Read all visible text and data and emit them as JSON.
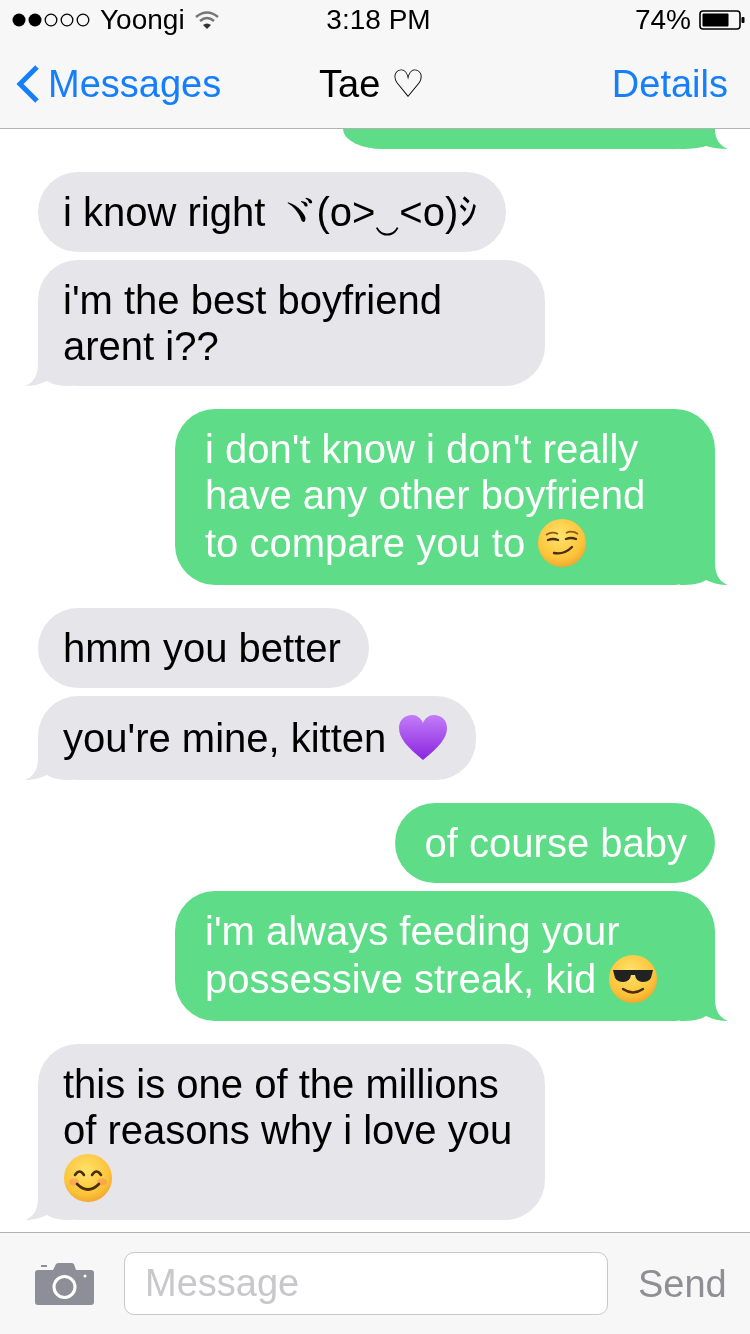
{
  "status_bar": {
    "carrier": "Yoongi",
    "time": "3:18 PM",
    "battery": "74%"
  },
  "nav_bar": {
    "back_label": "Messages",
    "title": "Tae ♡",
    "action": "Details"
  },
  "messages": [
    {
      "kind": "outgoing",
      "clipped": true
    },
    {
      "kind": "incoming",
      "clipped": false,
      "lines": [
        "i know right ヾ(o˃‿˂o)ｼ"
      ]
    },
    {
      "kind": "incoming",
      "clipped": false,
      "lines": [
        "i'm the best boyfriend",
        "arent i??"
      ]
    },
    {
      "kind": "outgoing",
      "clipped": false,
      "lines": [
        "i don't know i don't really",
        "have any other boyfriend",
        "to compare you to"
      ],
      "emoji": {
        "kind": "smirk"
      }
    },
    {
      "kind": "incoming",
      "clipped": false,
      "lines": [
        "hmm you better"
      ]
    },
    {
      "kind": "incoming",
      "clipped": false,
      "lines": [
        "you're mine, kitten"
      ],
      "emoji": {
        "kind": "heart"
      }
    },
    {
      "kind": "outgoing",
      "clipped": false,
      "lines": [
        "of course baby"
      ]
    },
    {
      "kind": "outgoing",
      "clipped": false,
      "lines": [
        "i'm always feeding your",
        "possessive streak, kid"
      ],
      "emoji": {
        "kind": "sunglasses"
      }
    },
    {
      "kind": "incoming",
      "clipped": false,
      "lines": [
        "this is one of the millions",
        "of reasons why i love you"
      ],
      "emoji": {
        "kind": "smile"
      }
    }
  ],
  "input_bar": {
    "placeholder": "Message",
    "send_button": {
      "label": "Send",
      "disabled": true
    }
  }
}
